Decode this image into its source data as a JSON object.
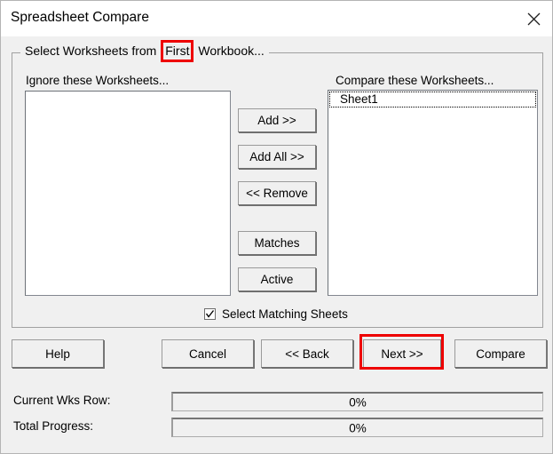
{
  "window": {
    "title": "Spreadsheet Compare",
    "close_icon": "close-icon"
  },
  "groupbox": {
    "legend_prefix": "Select Worksheets from ",
    "legend_highlight": "First",
    "legend_suffix": " Workbook..."
  },
  "lists": {
    "ignore": {
      "label": "Ignore these Worksheets...",
      "items": []
    },
    "compare": {
      "label": "Compare these Worksheets...",
      "items": [
        "Sheet1"
      ]
    }
  },
  "transfer_buttons": [
    {
      "name": "add-button",
      "label": "Add >>"
    },
    {
      "name": "add-all-button",
      "label": "Add All >>"
    },
    {
      "name": "remove-button",
      "label": "<< Remove"
    },
    {
      "name": "matches-button",
      "label": "Matches"
    },
    {
      "name": "active-button",
      "label": "Active"
    }
  ],
  "options": {
    "select_matching_sheets": {
      "label": "Select Matching Sheets",
      "checked": true
    }
  },
  "dialog_buttons": {
    "help": "Help",
    "cancel": "Cancel",
    "back": "<< Back",
    "next": "Next >>",
    "compare": "Compare"
  },
  "progress": {
    "current_row_label": "Current Wks Row:",
    "current_row_value": "0%",
    "total_label": "Total Progress:",
    "total_value": "0%"
  },
  "colors": {
    "highlight": "#ee0000",
    "dialog_face": "#f0f0f0",
    "titlebar": "#ffffff"
  }
}
